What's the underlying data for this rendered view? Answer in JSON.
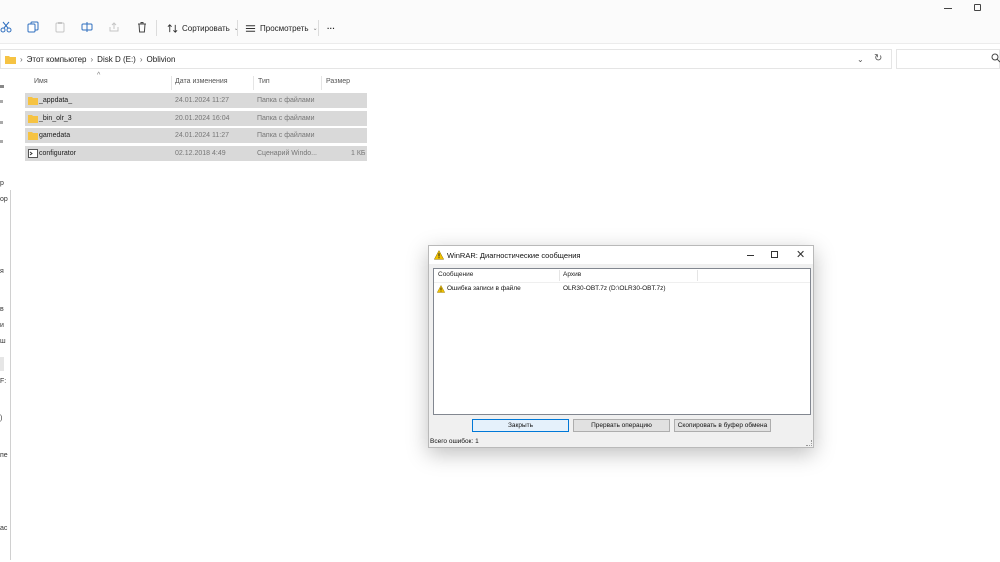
{
  "toolbar": {
    "sort_label": "Сортировать",
    "view_label": "Просмотреть",
    "more_label": "···"
  },
  "address": {
    "crumbs": [
      "Этот компьютер",
      "Disk D (E:)",
      "Oblivion"
    ]
  },
  "nav": {
    "fragments": [
      "р",
      "ор",
      "я",
      "в",
      "ш",
      "и",
      "F:",
      ")",
      "пе",
      "ас"
    ]
  },
  "file_list": {
    "columns": [
      "Имя",
      "Дата изменения",
      "Тип",
      "Размер"
    ],
    "rows": [
      {
        "icon": "folder-icon",
        "name": "_appdata_",
        "date": "24.01.2024 11:27",
        "type": "Папка с файлами",
        "size": ""
      },
      {
        "icon": "folder-icon",
        "name": "_bin_olr_3",
        "date": "20.01.2024 16:04",
        "type": "Папка с файлами",
        "size": ""
      },
      {
        "icon": "folder-icon",
        "name": "gamedata",
        "date": "24.01.2024 11:27",
        "type": "Папка с файлами",
        "size": ""
      },
      {
        "icon": "script-file-icon",
        "name": "configurator",
        "date": "02.12.2018 4:49",
        "type": "Сценарий Windo...",
        "size": "1 КБ"
      }
    ]
  },
  "dialog": {
    "title": "WinRAR: Диагностические сообщения",
    "close_glyph": "✕",
    "list_headers": [
      "Сообщение",
      "Архив"
    ],
    "messages": [
      {
        "icon": "warning-icon",
        "message": "Ошибка записи в файле",
        "archive": "OLR30-OBT.7z (D:\\OLR30-OBT.7z)"
      }
    ],
    "buttons": {
      "close": "Закрыть",
      "abort": "Прервать операцию",
      "copy": "Скопировать в буфер обмена"
    },
    "status": "Всего ошибок: 1"
  },
  "colors": {
    "folder": "#f6c343",
    "selection_row": "#d9d9d9",
    "dialog_bg": "#f0f0f0",
    "default_button_border": "#0078d7",
    "warning": "#f2c200"
  }
}
